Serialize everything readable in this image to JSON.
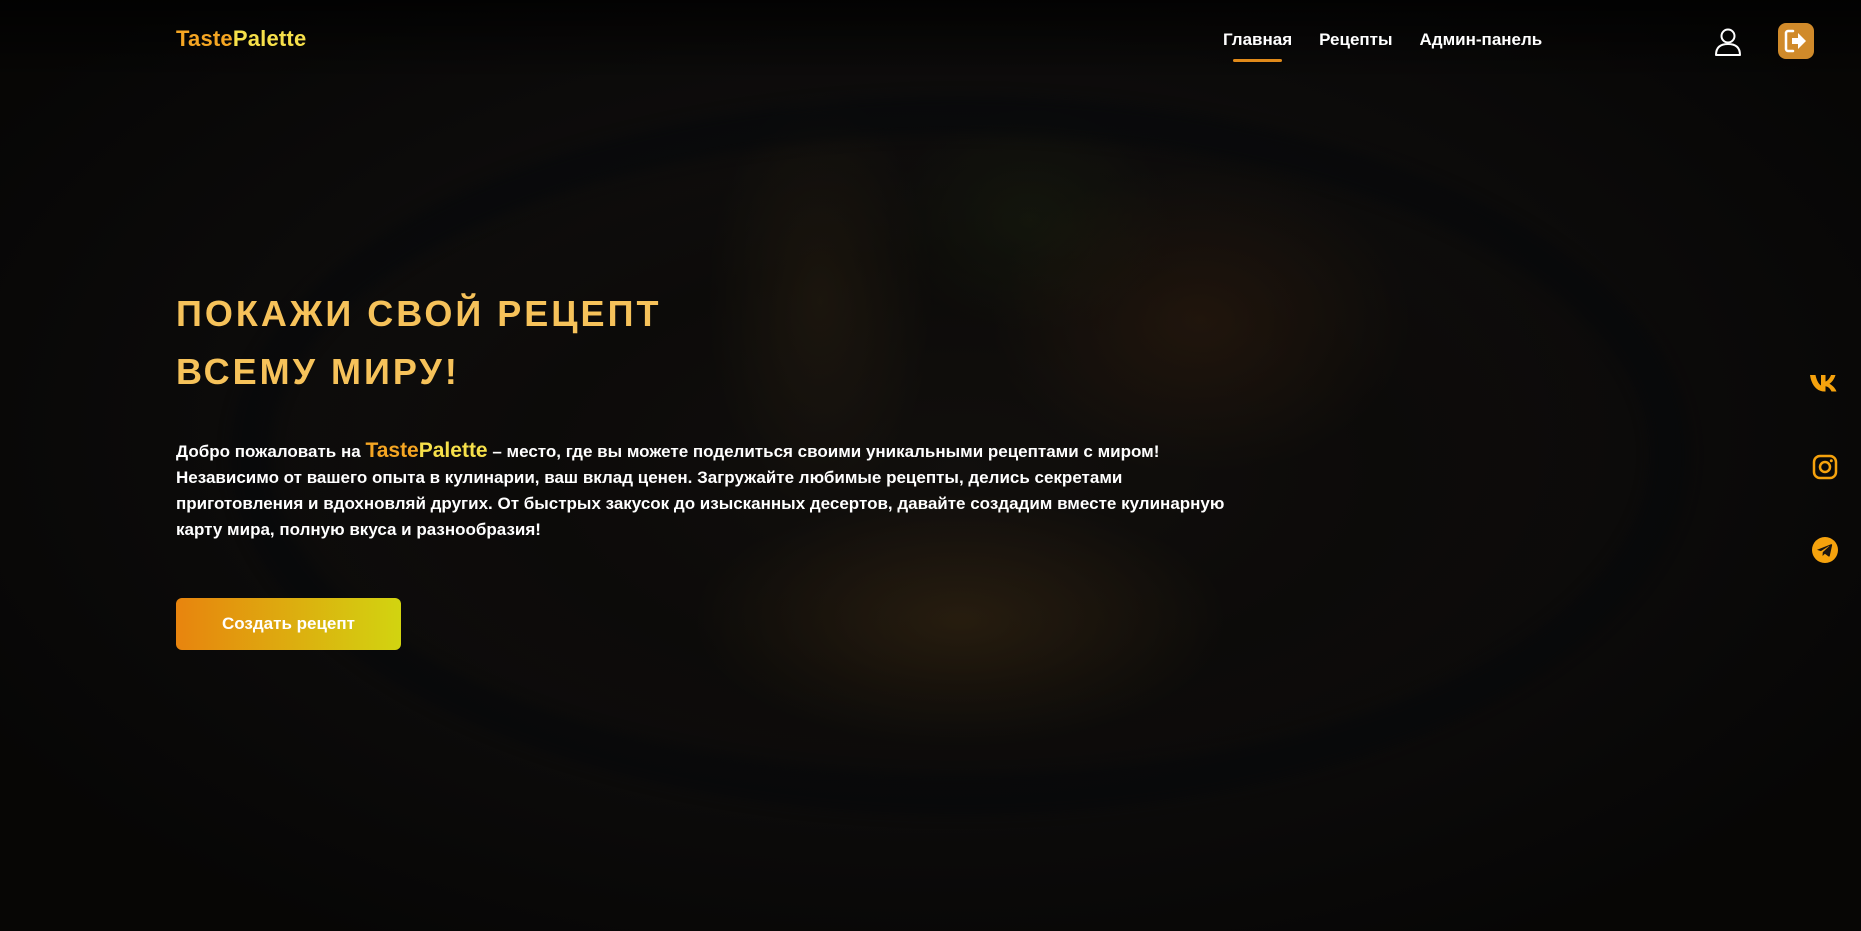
{
  "brand": {
    "part1": "Taste",
    "part2": "Palette"
  },
  "nav": {
    "items": [
      {
        "label": "Главная"
      },
      {
        "label": "Рецепты"
      },
      {
        "label": "Админ-панель"
      }
    ]
  },
  "header_icons": {
    "user": "user-icon",
    "logout": "logout-icon"
  },
  "hero": {
    "title_line1": "ПОКАЖИ СВОЙ РЕЦЕПТ",
    "title_line2": "ВСЕМУ МИРУ!",
    "text_before": "Добро пожаловать на ",
    "text_after": " – место, где вы можете поделиться своими уникальными рецептами с миром! Независимо от вашего опыта в кулинарии, ваш вклад ценен. Загружайте любимые рецепты, делись секретами приготовления и вдохновляй других. От быстрых закусок до изысканных десертов, давайте создадим вместе кулинарную карту мира, полную вкуса и разнообразия!",
    "cta_label": "Создать рецепт"
  },
  "social": {
    "items": [
      "vk-icon",
      "instagram-icon",
      "telegram-icon"
    ]
  },
  "colors": {
    "accent_orange": "#f5a623",
    "accent_yellow": "#f6e04a",
    "title_color": "#f6c25a",
    "logout_bg": "#d08a2a",
    "social_color": "#f5a20d"
  }
}
